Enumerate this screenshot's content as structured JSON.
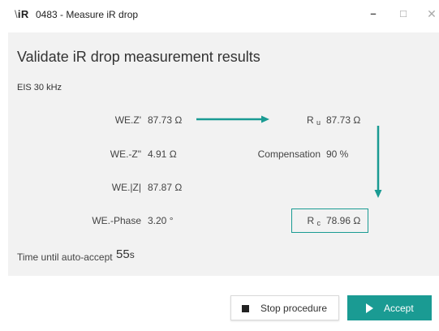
{
  "window": {
    "logo": "iR",
    "title": "0483 - Measure iR drop",
    "minimize_glyph": "–",
    "maximize_glyph": "□",
    "close_glyph": "✕"
  },
  "panel": {
    "heading": "Validate iR drop measurement results",
    "section": "EIS 30 kHz",
    "measurements": [
      {
        "label": "WE.Z'",
        "value": "87.73 Ω"
      },
      {
        "label": "WE.-Z\"",
        "value": "4.91 Ω"
      },
      {
        "label": "WE.|Z|",
        "value": "87.87 Ω"
      },
      {
        "label": "WE.-Phase",
        "value": "3.20 °"
      }
    ],
    "ru": {
      "symbol": "R",
      "sub": "u",
      "value": "87.73 Ω"
    },
    "compensation": {
      "label": "Compensation",
      "value": "90 %"
    },
    "rc": {
      "symbol": "R",
      "sub": "c",
      "value": "78.96 Ω"
    },
    "timer": {
      "label": "Time until auto-accept",
      "value": "55",
      "unit": "s"
    }
  },
  "footer": {
    "stop_label": "Stop procedure",
    "accept_label": "Accept"
  },
  "colors": {
    "accent": "#1a9b93",
    "panel_bg": "#f2f2f2"
  },
  "icons": {
    "stop": "stop-square-icon",
    "play": "play-icon",
    "arrow_right": "arrow-right-icon",
    "arrow_down": "arrow-down-icon"
  }
}
